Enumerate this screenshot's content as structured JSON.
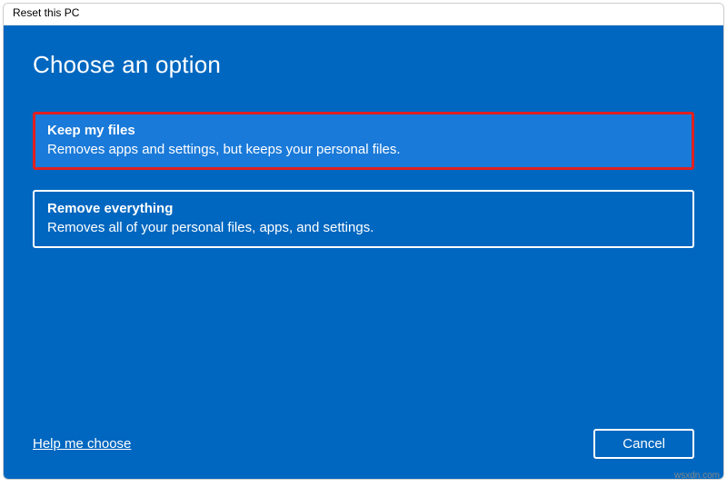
{
  "window": {
    "title": "Reset this PC"
  },
  "heading": "Choose an option",
  "options": [
    {
      "title": "Keep my files",
      "description": "Removes apps and settings, but keeps your personal files."
    },
    {
      "title": "Remove everything",
      "description": "Removes all of your personal files, apps, and settings."
    }
  ],
  "footer": {
    "help_link": "Help me choose",
    "cancel_label": "Cancel"
  },
  "watermark": "wsxdn.com"
}
